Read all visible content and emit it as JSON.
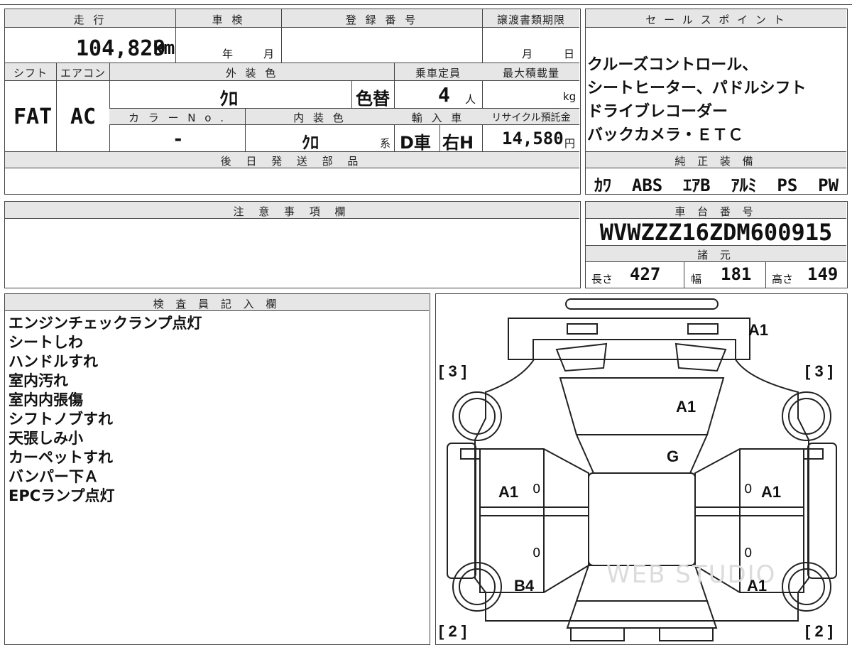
{
  "top_info": {
    "mileage_label": "走 行",
    "mileage_value": "104,829",
    "mileage_unit": "km",
    "inspection_label": "車 検",
    "inspection_year": "年",
    "inspection_month": "月",
    "registration_label": "登 録 番 号",
    "transfer_label": "譲渡書類期限",
    "transfer_month": "月",
    "transfer_day": "日",
    "shift_label": "シフト",
    "shift_value": "FAT",
    "ac_label": "エアコン",
    "ac_value": "AC",
    "exterior_label": "外 装 色",
    "exterior_value": "ｸﾛ",
    "repaint_value": "色替",
    "capacity_label": "乗車定員",
    "capacity_value": "4",
    "capacity_unit": "人",
    "max_load_label": "最大積載量",
    "max_load_unit": "kg",
    "color_no_label": "カ ラ ー N o .",
    "color_no_value": "-",
    "interior_label": "内 装 色",
    "interior_value": "ｸﾛ",
    "interior_suffix": "系",
    "import_label": "輸 入 車",
    "import_value": "D車",
    "steering_value": "右H",
    "recycle_label": "リサイクル預託金",
    "recycle_value": "14,580",
    "recycle_unit": "円",
    "later_parts_label": "後 日 発 送 部 品"
  },
  "sales_point": {
    "label": "セ ー ル ス ポ イ ン ト",
    "lines": [
      "クルーズコントロール、",
      "シートヒーター、パドルシフト",
      "ドライブレコーダー",
      "バックカメラ・ＥＴＣ"
    ]
  },
  "equipment": {
    "label": "純 正 装 備",
    "value": "ｶﾜ  ABS  ｴｱB  ｱﾙﾐ  PS  PW"
  },
  "caution": {
    "label": "注 意 事 項 欄"
  },
  "chassis": {
    "label": "車 台 番 号",
    "value": "WVWZZZ16ZDM600915"
  },
  "specs": {
    "label": "諸 元",
    "length_label": "長さ",
    "length_value": "427",
    "width_label": "幅",
    "width_value": "181",
    "height_label": "高さ",
    "height_value": "149"
  },
  "inspector": {
    "label": "検 査 員 記 入 欄",
    "notes": [
      "エンジンチェックランプ点灯",
      "シートしわ",
      "ハンドルすれ",
      "室内汚れ",
      "室内内張傷",
      "シフトノブすれ",
      "天張しみ小",
      "カーペットすれ",
      "バンパー下Ａ",
      "EPCランプ点灯"
    ]
  },
  "diagram": {
    "codes": {
      "front_bumper": "A1",
      "hood": "A1",
      "windshield": "G",
      "left_front_door": "A1",
      "right_front_door": "A1",
      "left_rear": "B4",
      "right_rear": "A1"
    },
    "tread_marks": {
      "front_left": "[ 3 ]",
      "front_right": "[ 3 ]",
      "rear_left": "[ 2 ]",
      "rear_right": "[ 2 ]"
    },
    "zeros": {
      "lf": "0",
      "rf": "0",
      "lr": "0",
      "rr": "0"
    },
    "watermark": "WEB STUDIO"
  }
}
